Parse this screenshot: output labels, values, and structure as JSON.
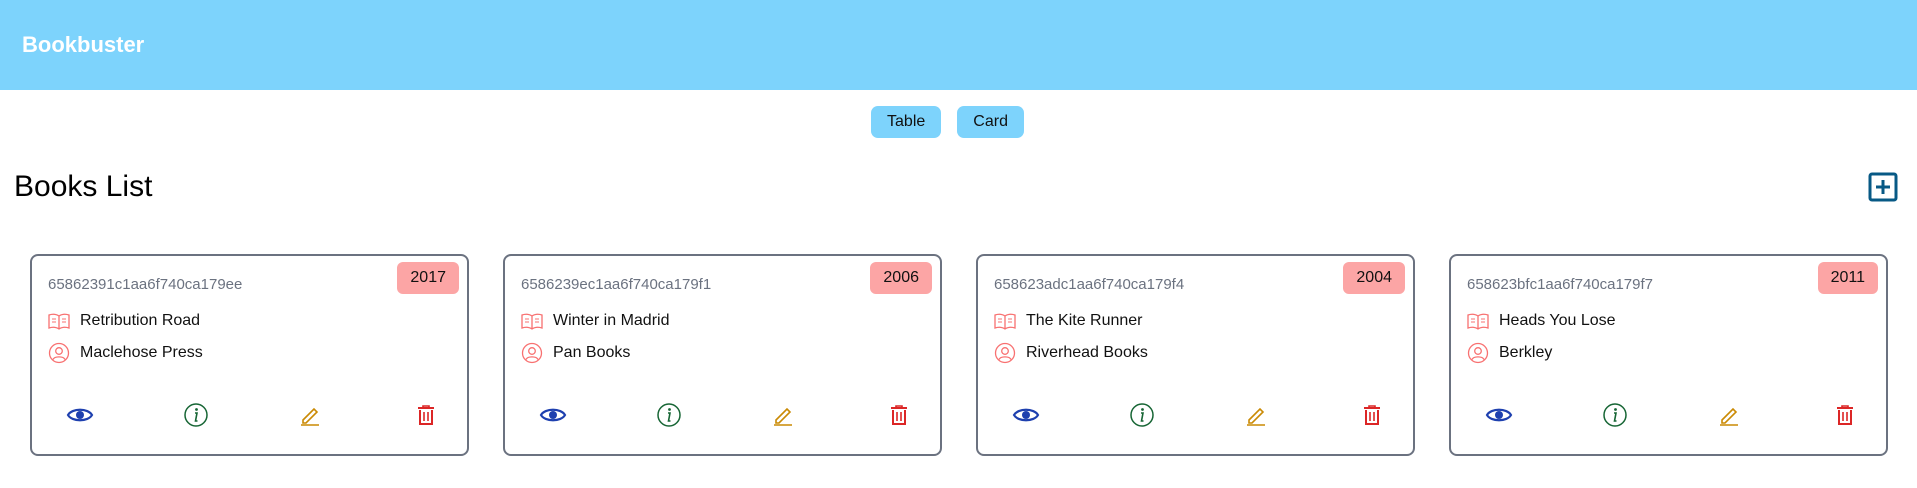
{
  "navbar": {
    "brand": "Bookbuster"
  },
  "view_toggle": {
    "table_label": "Table",
    "card_label": "Card"
  },
  "page": {
    "title": "Books List",
    "add_icon": "plus-square-icon"
  },
  "colors": {
    "navbar": "#7dd3fc",
    "badge": "#fca5a5",
    "view": "#1e40af",
    "info": "#166534",
    "edit": "#ca8a04",
    "delete": "#dc2626",
    "field_icon": "#f87171"
  },
  "books": [
    {
      "id": "65862391c1aa6f740ca179ee",
      "year": "2017",
      "title": "Retribution Road",
      "publisher": "Maclehose Press"
    },
    {
      "id": "6586239ec1aa6f740ca179f1",
      "year": "2006",
      "title": "Winter in Madrid",
      "publisher": "Pan Books"
    },
    {
      "id": "658623adc1aa6f740ca179f4",
      "year": "2004",
      "title": "The Kite Runner",
      "publisher": "Riverhead Books"
    },
    {
      "id": "658623bfc1aa6f740ca179f7",
      "year": "2011",
      "title": "Heads You Lose",
      "publisher": "Berkley"
    }
  ]
}
